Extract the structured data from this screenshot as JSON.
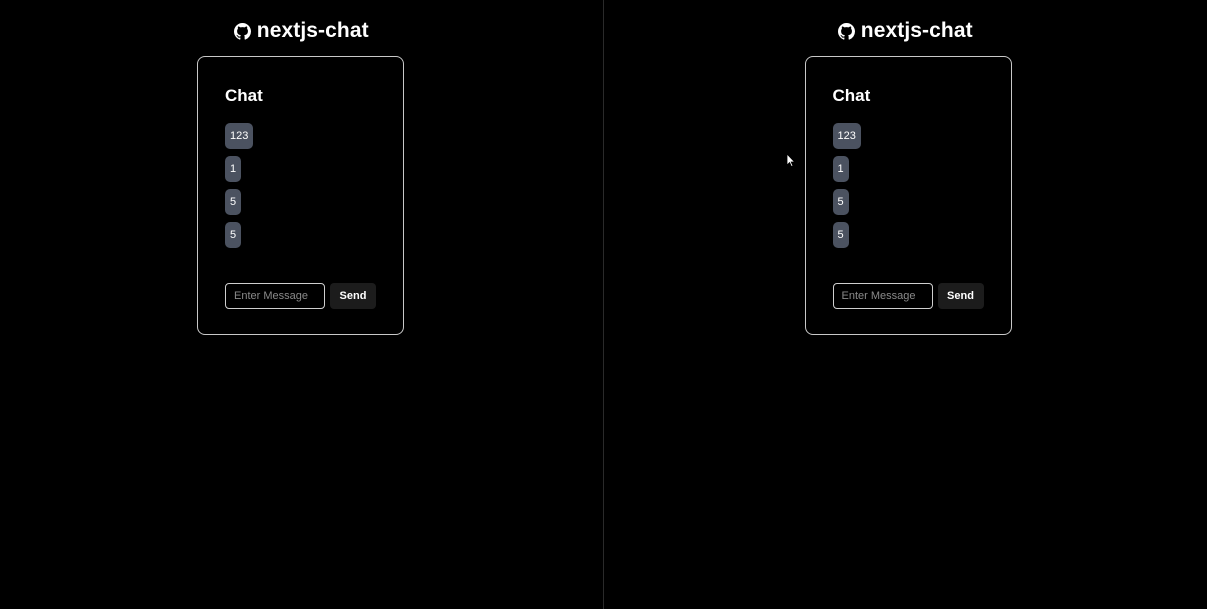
{
  "panes": [
    {
      "header": {
        "title": "nextjs-chat",
        "icon": "github-icon"
      },
      "card": {
        "title": "Chat",
        "messages": [
          "123",
          "1",
          "5",
          "5"
        ],
        "input": {
          "placeholder": "Enter Message",
          "value": ""
        },
        "send_label": "Send"
      }
    },
    {
      "header": {
        "title": "nextjs-chat",
        "icon": "github-icon"
      },
      "card": {
        "title": "Chat",
        "messages": [
          "123",
          "1",
          "5",
          "5"
        ],
        "input": {
          "placeholder": "Enter Message",
          "value": ""
        },
        "send_label": "Send"
      }
    }
  ],
  "colors": {
    "background": "#000000",
    "card_border": "#c8c8c8",
    "message_bubble": "#4b5260",
    "send_button": "#1c1c1c",
    "divider": "#2a2a2a"
  }
}
